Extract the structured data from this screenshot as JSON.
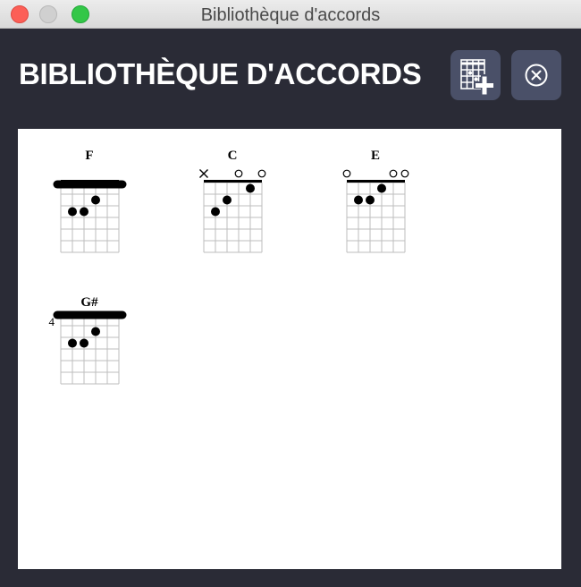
{
  "window": {
    "title": "Bibliothèque d'accords"
  },
  "header": {
    "title": "BIBLIOTHÈQUE D'ACCORDS",
    "add_button_icon": "add-chord-grid-icon",
    "close_button_icon": "circle-x-icon"
  },
  "chords": [
    {
      "name": "F",
      "start_fret": "",
      "markers": [
        "none",
        "none",
        "none",
        "none",
        "none",
        "none"
      ],
      "nut": true,
      "barre": 1,
      "dots": [
        {
          "string": 4,
          "fret": 2
        },
        {
          "string": 2,
          "fret": 3
        },
        {
          "string": 3,
          "fret": 3
        }
      ]
    },
    {
      "name": "C",
      "start_fret": "",
      "markers": [
        "mute",
        "none",
        "none",
        "open",
        "none",
        "open"
      ],
      "nut": true,
      "barre": null,
      "dots": [
        {
          "string": 5,
          "fret": 1
        },
        {
          "string": 3,
          "fret": 2
        },
        {
          "string": 2,
          "fret": 3
        }
      ]
    },
    {
      "name": "E",
      "start_fret": "",
      "markers": [
        "open",
        "none",
        "none",
        "none",
        "open",
        "open"
      ],
      "nut": true,
      "barre": null,
      "dots": [
        {
          "string": 4,
          "fret": 1
        },
        {
          "string": 2,
          "fret": 2
        },
        {
          "string": 3,
          "fret": 2
        }
      ]
    },
    {
      "name": "G#",
      "start_fret": "4",
      "markers": [
        "none",
        "none",
        "none",
        "none",
        "none",
        "none"
      ],
      "nut": false,
      "barre": 1,
      "dots": [
        {
          "string": 4,
          "fret": 2
        },
        {
          "string": 2,
          "fret": 3
        },
        {
          "string": 3,
          "fret": 3
        }
      ]
    }
  ]
}
